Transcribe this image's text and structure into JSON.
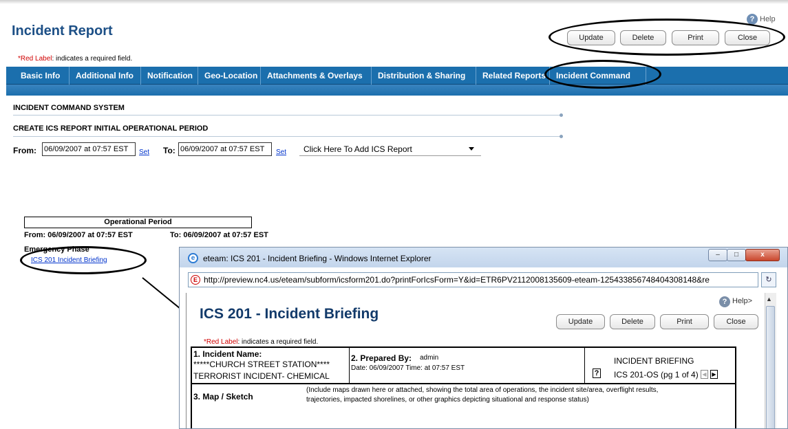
{
  "header": {
    "title": "Incident Report",
    "help_label": "Help",
    "buttons": {
      "update": "Update",
      "delete": "Delete",
      "print": "Print",
      "close": "Close"
    },
    "required_note_red": "*Red Label",
    "required_note_rest": ": indicates a required field."
  },
  "tabs": [
    {
      "label": "Basic Info"
    },
    {
      "label": "Additional Info"
    },
    {
      "label": "Notification"
    },
    {
      "label": "Geo-Location"
    },
    {
      "label": "Attachments & Overlays"
    },
    {
      "label": "Distribution & Sharing"
    },
    {
      "label": "Related Reports"
    },
    {
      "label": "Incident Command"
    }
  ],
  "ics": {
    "section_title": "INCIDENT COMMAND SYSTEM",
    "create_title": "CREATE ICS REPORT INITIAL OPERATIONAL PERIOD",
    "from_label": "From:",
    "to_label": "To:",
    "from_value": "06/09/2007 at 07:57 EST",
    "to_value": "06/09/2007 at 07:57 EST",
    "set_label": "Set",
    "add_report_select": "Click Here To Add ICS Report"
  },
  "operational_period": {
    "header": "Operational Period",
    "from_text": "From: 06/09/2007 at 07:57 EST",
    "to_text": "To: 06/09/2007 at 07:57 EST",
    "phase": "Emergency Phase",
    "link": "ICS 201 Incident Briefing"
  },
  "popup": {
    "window_title": "eteam: ICS 201 - Incident Briefing - Windows Internet Explorer",
    "url": "http://preview.nc4.us/eteam/subform/icsform201.do?printForIcsForm=Y&id=ETR6PV2112008135609-eteam-125433856748404308148&re",
    "help_label": "Help>",
    "form_title": "ICS 201 - Incident Briefing",
    "buttons": {
      "update": "Update",
      "delete": "Delete",
      "print": "Print",
      "close": "Close"
    },
    "required_note_red": "*Red Label",
    "required_note_rest": ": indicates a required field.",
    "incident_name_label": "1. Incident Name:",
    "incident_name_line1": "*****CHURCH STREET STATION****",
    "incident_name_line2": "TERRORIST INCIDENT- CHEMICAL",
    "prepared_by_label": "2. Prepared By:",
    "prepared_by_value": "admin",
    "prepared_date": "Date: 06/09/2007   Time: at 07:57 EST",
    "briefing_title": "INCIDENT BRIEFING",
    "briefing_form": "ICS 201-OS (pg 1 of 4)",
    "qmark": "?",
    "map_label": "3. Map / Sketch",
    "map_note_line1": "(Include maps drawn here or attached, showing the total area of operations, the incident site/area, overflight results,",
    "map_note_line2": "trajectories, impacted shorelines, or other graphics depicting situational and response status)"
  },
  "icons": [
    "help-icon",
    "ie-icon",
    "address-icon",
    "refresh-icon",
    "minimize-icon",
    "maximize-icon",
    "close-icon",
    "nav-prev-icon",
    "nav-next-icon",
    "dropdown-caret-icon",
    "scroll-up-icon"
  ]
}
